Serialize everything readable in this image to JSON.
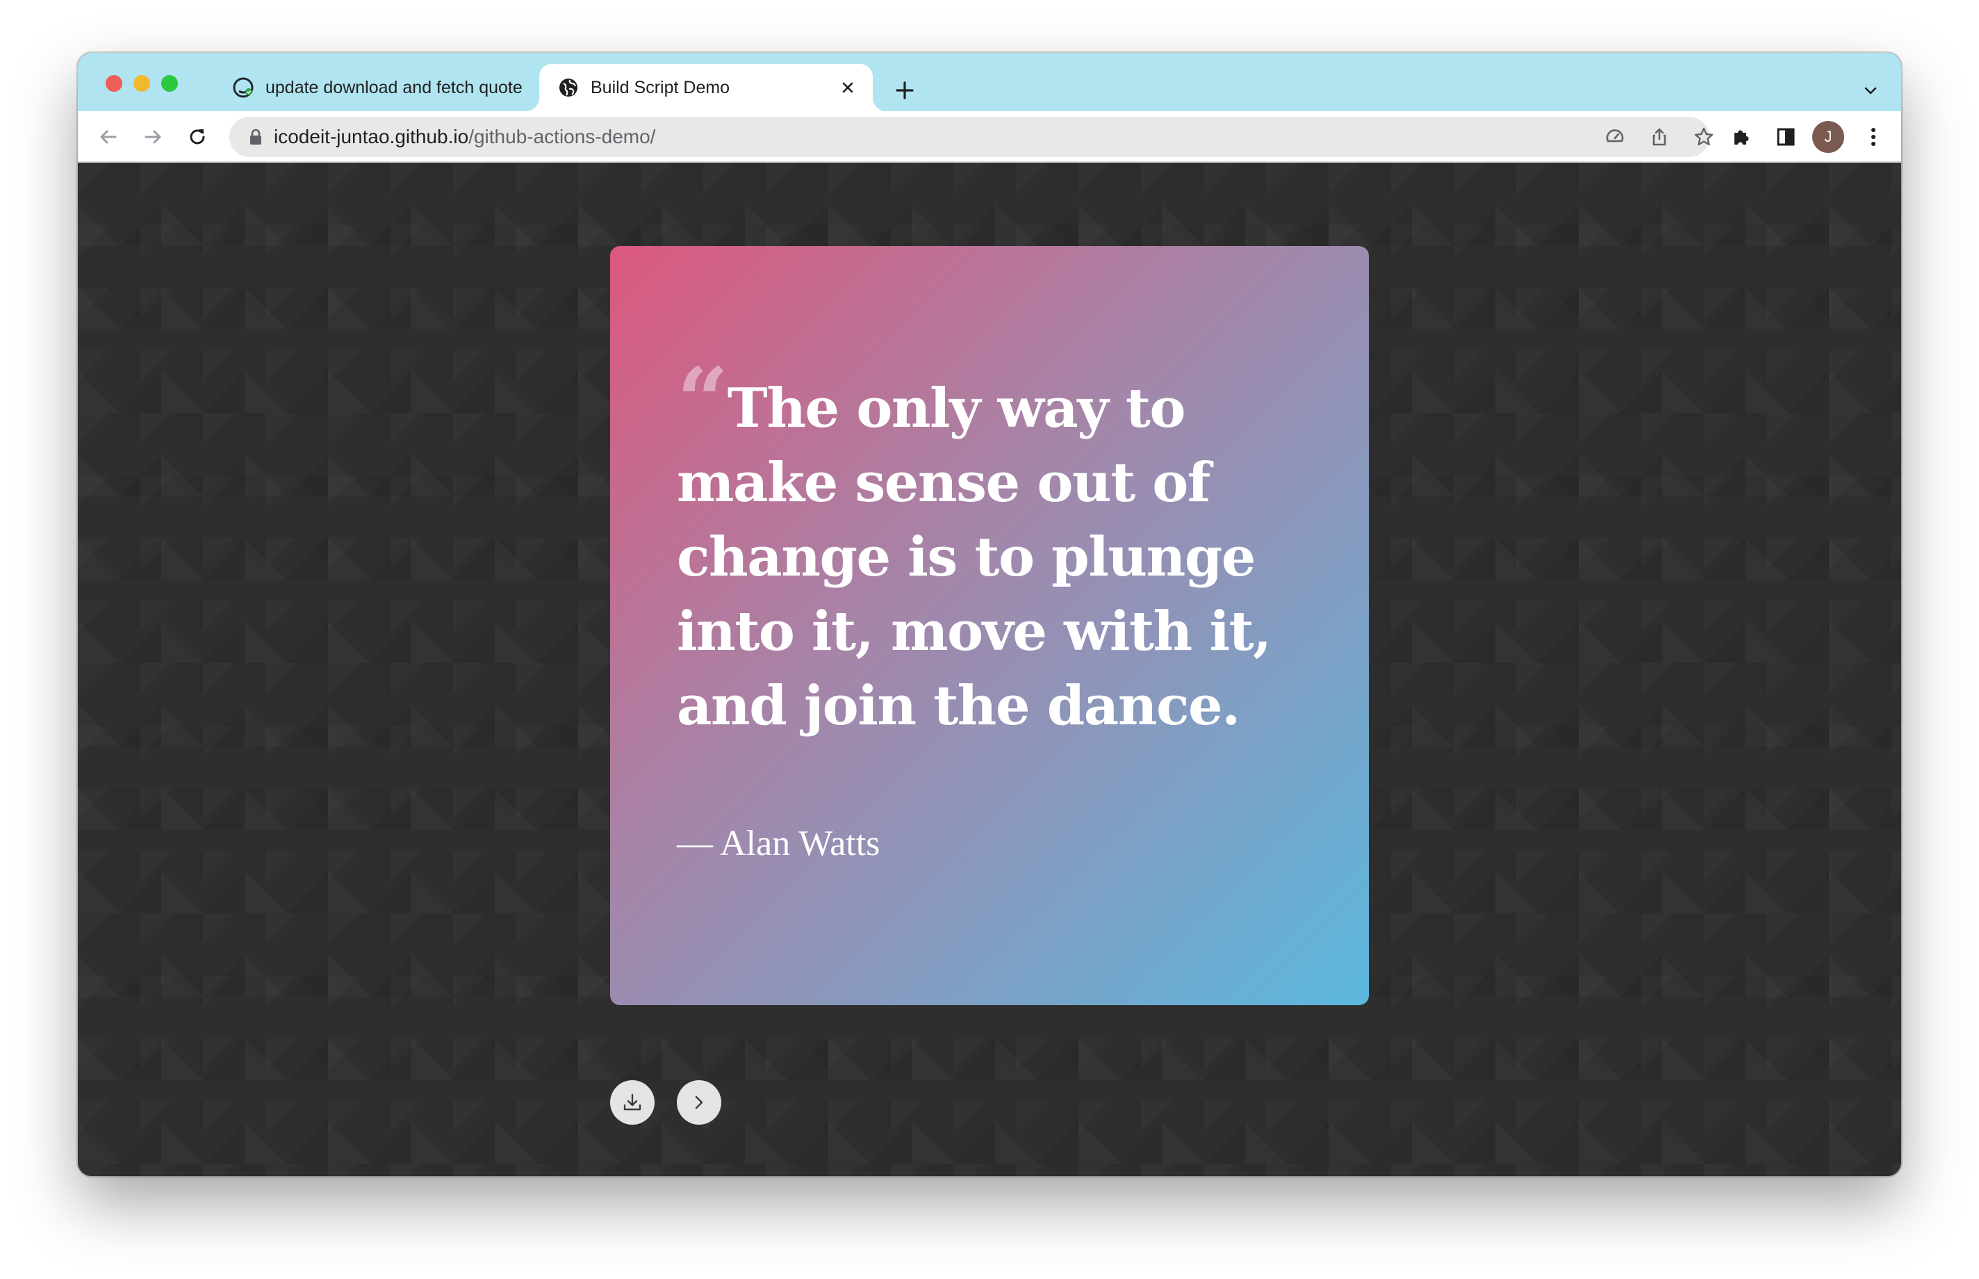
{
  "browser": {
    "tabs": [
      {
        "title": "update download and fetch quote",
        "favicon": "github-icon",
        "active": false
      },
      {
        "title": "Build Script Demo",
        "favicon": "globe-icon",
        "active": true
      }
    ],
    "address_bar": {
      "host": "icodeit-juntao.github.io",
      "path": "/github-actions-demo/"
    },
    "profile_initial": "J"
  },
  "quote_card": {
    "open_quote_mark": "“",
    "text": "The only way to make sense out of change is to plunge into it, move with it, and join the dance.",
    "author": "— Alan Watts",
    "gradient_colors": [
      "#dc587e",
      "#a585a8",
      "#859bc0",
      "#5bb8de"
    ]
  },
  "actions": {
    "download_icon": "download-icon",
    "next_icon": "chevron-right-icon"
  },
  "colors": {
    "tab_strip": "#b0e4f0",
    "page_background": "#2e2e2e",
    "button_background": "#e4e4e4"
  }
}
